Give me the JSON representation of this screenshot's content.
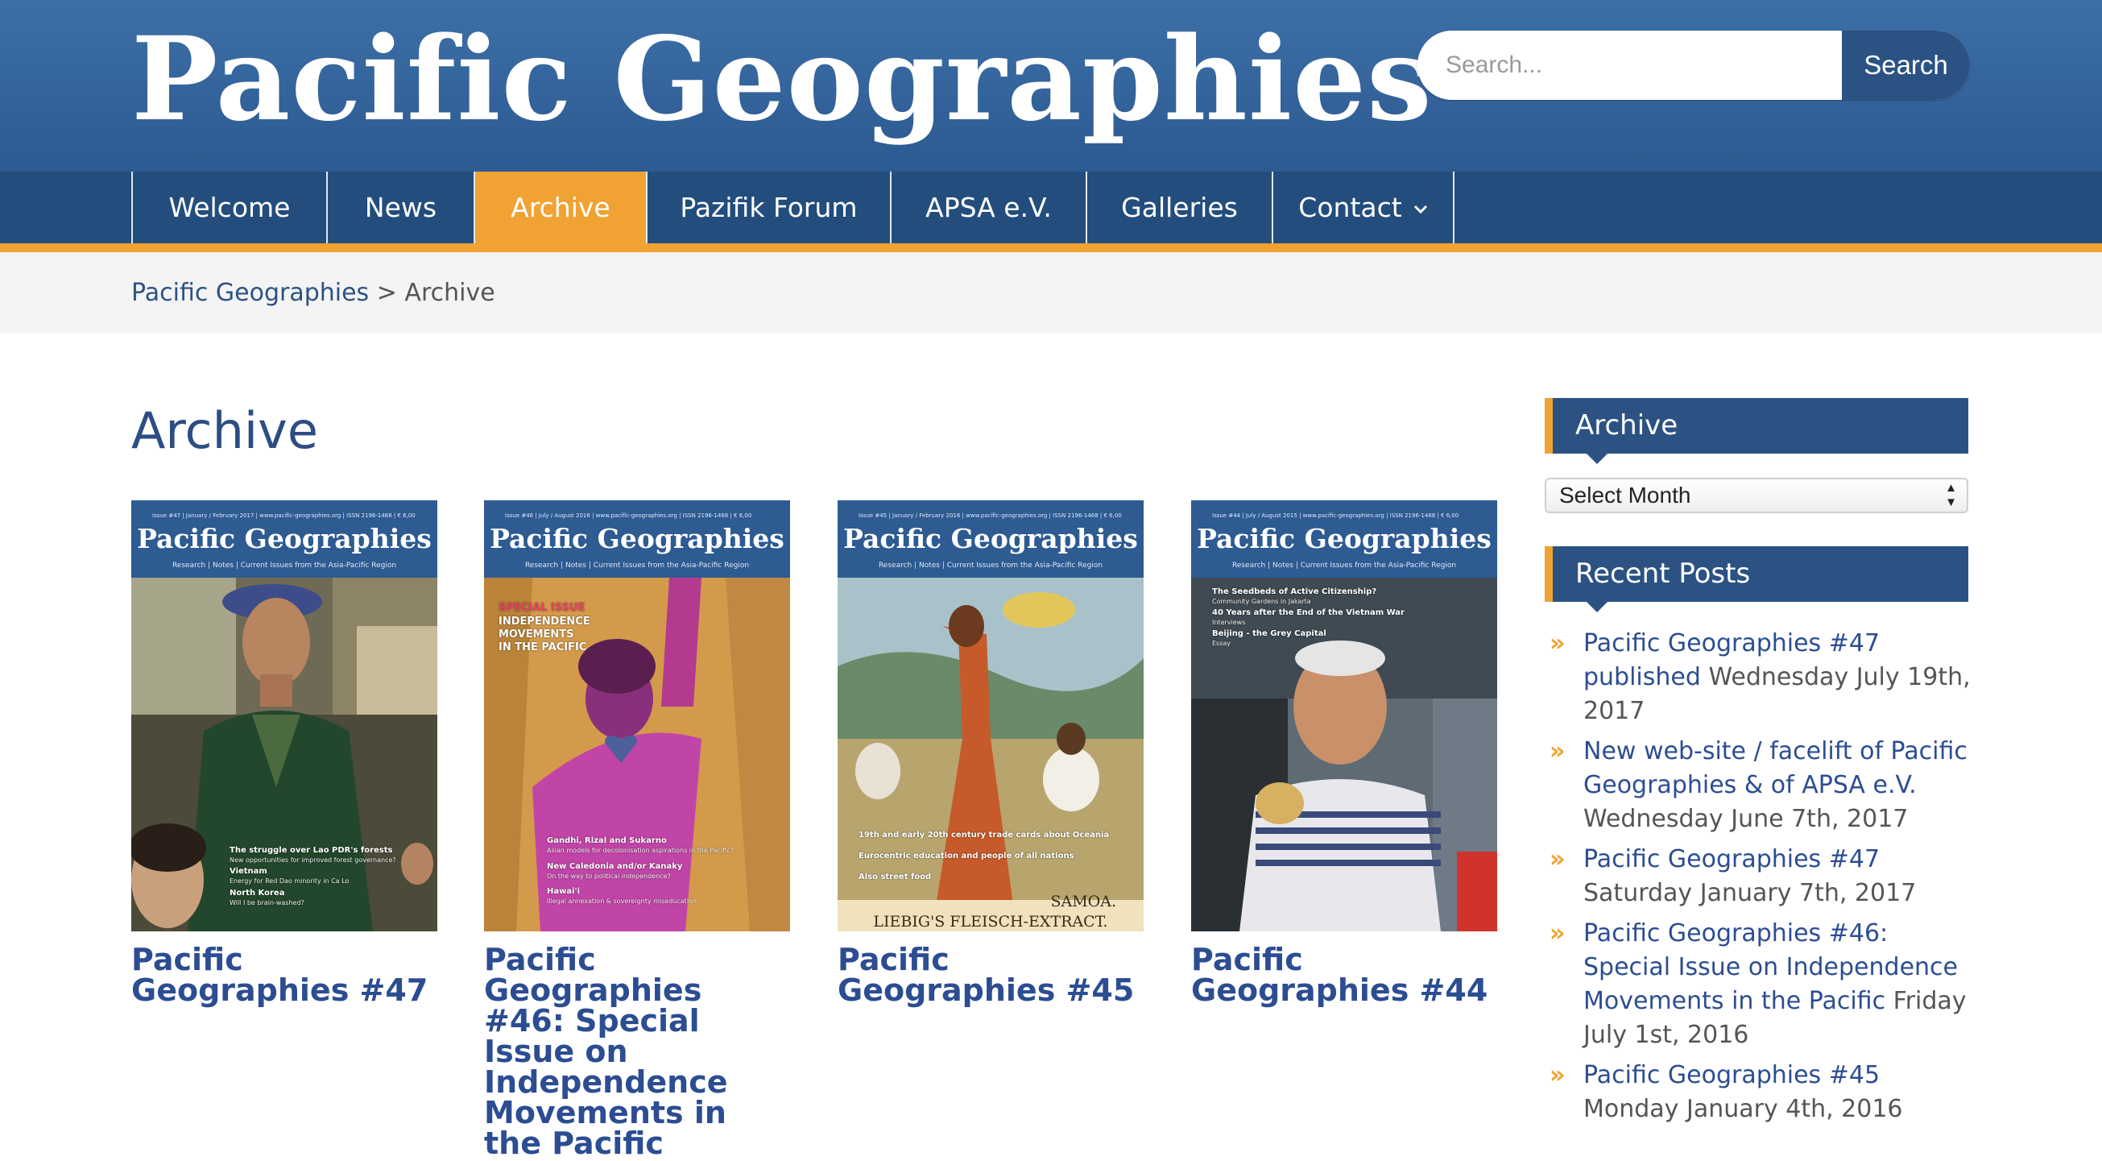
{
  "header": {
    "site_title": "Pacific Geographies",
    "search": {
      "placeholder": "Search...",
      "button_label": "Search"
    }
  },
  "nav": {
    "items": [
      {
        "label": "Welcome"
      },
      {
        "label": "News"
      },
      {
        "label": "Archive",
        "active": true
      },
      {
        "label": "Pazifik Forum"
      },
      {
        "label": "APSA e.V."
      },
      {
        "label": "Galleries"
      },
      {
        "label": "Contact",
        "dropdown": true
      }
    ],
    "dropdown_icon": "chevron-down-icon"
  },
  "breadcrumb": {
    "home": "Pacific Geographies",
    "separator": ">",
    "current": "Archive"
  },
  "page_title": "Archive",
  "issues": [
    {
      "title": "Pacific Geographies #47",
      "cover": {
        "masthead": "Pacific Geographies",
        "meta": "Issue #47 | January / February 2017 | www.pacific-geographies.org | ISSN 2196-1468 | € 6,00",
        "subtitle": "Research | Notes | Current Issues from the Asia-Pacific Region",
        "headlines": [
          "The struggle over Lao PDR's forests",
          "New opportunities for improved forest governance?",
          "Vietnam",
          "Energy for Red Dao minority in Ca Lo",
          "North Korea",
          "Will I be brain-washed?"
        ]
      }
    },
    {
      "title": "Pacific Geographies #46: Special Issue on Independence Movements in the Pacific",
      "cover": {
        "masthead": "Pacific Geographies",
        "meta": "Issue #46 | July / August 2016 | www.pacific-geographies.org | ISSN 2196-1468 | € 6,00",
        "subtitle": "Research | Notes | Current Issues from the Asia-Pacific Region",
        "special": "SPECIAL ISSUE",
        "special_title": [
          "INDEPENDENCE",
          "MOVEMENTS",
          "IN THE PACIFIC"
        ],
        "headlines": [
          "Gandhi, Rizal and Sukarno",
          "Asian models for decolonisation aspirations in the Pacific?",
          "New Caledonia and/or Kanaky",
          "On the way to political independence?",
          "Hawai'i",
          "Illegal annexation & sovereignty miseducation"
        ]
      }
    },
    {
      "title": "Pacific Geographies #45",
      "cover": {
        "masthead": "Pacific Geographies",
        "meta": "Issue #45 | January / February 2016 | www.pacific-geographies.org | ISSN 2196-1468 | € 6,00",
        "subtitle": "Research | Notes | Current Issues from the Asia-Pacific Region",
        "headlines": [
          "19th and early 20th century trade cards about Oceania",
          "Eurocentric education and people of all nations",
          "Also street food"
        ],
        "card_caption": "SAMOA.",
        "card_brand": "LIEBIG'S FLEISCH-EXTRACT."
      }
    },
    {
      "title": "Pacific Geographies #44",
      "cover": {
        "masthead": "Pacific Geographies",
        "meta": "Issue #44 | July / August 2015 | www.pacific-geographies.org | ISSN 2196-1468 | € 6,00",
        "subtitle": "Research | Notes | Current Issues from the Asia-Pacific Region",
        "headlines": [
          "The Seedbeds of Active Citizenship?",
          "Community Gardens in Jakarta",
          "40 Years after the End of the Vietnam War",
          "Interviews",
          "Beijing - the Grey Capital",
          "Essay"
        ]
      }
    }
  ],
  "sidebar": {
    "archive_title": "Archive",
    "select_label": "Select Month",
    "recent_title": "Recent Posts",
    "recent_posts": [
      {
        "title": "Pacific Geographies #47 published",
        "date": "Wednesday July 19th, 2017"
      },
      {
        "title": "New web-site / facelift of Pacific Geographies & of APSA e.V.",
        "date": "Wednesday June 7th, 2017"
      },
      {
        "title": "Pacific Geographies #47",
        "date": "Saturday January 7th, 2017"
      },
      {
        "title": "Pacific Geographies #46: Special Issue on Independence Movements in the Pacific",
        "date": "Friday July 1st, 2016"
      },
      {
        "title": "Pacific Geographies #45",
        "date": "Monday January 4th, 2016"
      }
    ],
    "bullet_icon": "double-chevron-right-icon"
  },
  "colors": {
    "header_blue": "#2c5a91",
    "nav_blue": "#234d7c",
    "accent_orange": "#f0a233",
    "link_blue": "#2c4d92"
  }
}
